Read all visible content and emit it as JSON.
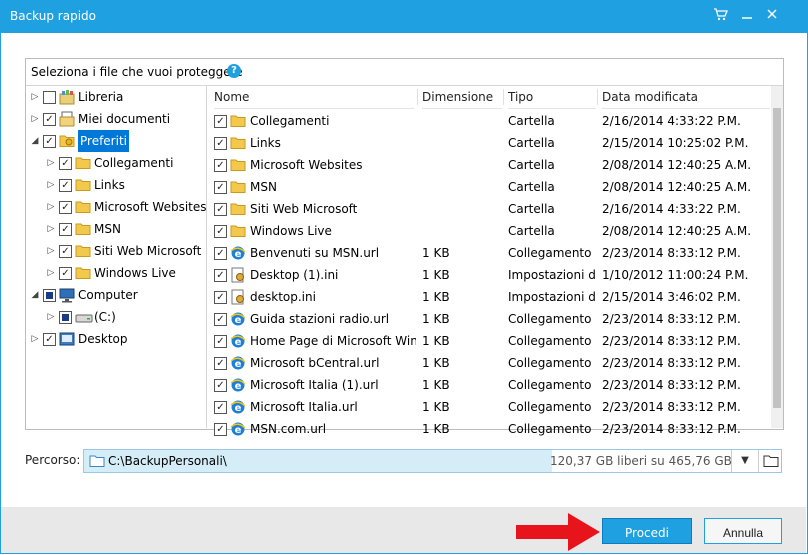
{
  "window": {
    "title": "Backup rapido"
  },
  "panel": {
    "instruction": "Seleziona i file che vuoi proteggere",
    "help_glyph": "?"
  },
  "tree": {
    "items": [
      {
        "label": "Libreria",
        "icon": "library-icon",
        "checked": "unchecked",
        "expander": "collapsed"
      },
      {
        "label": "Miei documenti",
        "icon": "documents-icon",
        "checked": "checked",
        "expander": "collapsed"
      },
      {
        "label": "Preferiti",
        "icon": "favorites-folder-icon",
        "checked": "checked",
        "expander": "expanded",
        "selected": true
      },
      {
        "label": "Collegamenti",
        "icon": "folder-icon",
        "checked": "checked",
        "expander": "collapsed"
      },
      {
        "label": "Links",
        "icon": "folder-icon",
        "checked": "checked",
        "expander": "collapsed"
      },
      {
        "label": "Microsoft Websites",
        "icon": "folder-icon",
        "checked": "checked",
        "expander": "collapsed"
      },
      {
        "label": "MSN",
        "icon": "folder-icon",
        "checked": "checked",
        "expander": "collapsed"
      },
      {
        "label": "Siti Web Microsoft",
        "icon": "folder-icon",
        "checked": "checked",
        "expander": "collapsed"
      },
      {
        "label": "Windows Live",
        "icon": "folder-icon",
        "checked": "checked",
        "expander": "collapsed"
      },
      {
        "label": "Computer",
        "icon": "computer-icon",
        "checked": "partial",
        "expander": "expanded"
      },
      {
        "label": "(C:)",
        "icon": "drive-icon",
        "checked": "partial",
        "expander": "collapsed"
      },
      {
        "label": "Desktop",
        "icon": "desktop-icon",
        "checked": "checked",
        "expander": "collapsed"
      }
    ]
  },
  "list": {
    "columns": [
      "Nome",
      "Dimensione",
      "Tipo",
      "Data modificata"
    ],
    "rows": [
      {
        "name": "Collegamenti",
        "size": "",
        "type": "Cartella",
        "date": "2/16/2014 4:33:22 P.M.",
        "icon": "folder-icon"
      },
      {
        "name": "Links",
        "size": "",
        "type": "Cartella",
        "date": "2/15/2014 10:25:02 P.M.",
        "icon": "folder-icon"
      },
      {
        "name": "Microsoft Websites",
        "size": "",
        "type": "Cartella",
        "date": "2/08/2014 12:40:25 A.M.",
        "icon": "folder-icon"
      },
      {
        "name": "MSN",
        "size": "",
        "type": "Cartella",
        "date": "2/08/2014 12:40:25 A.M.",
        "icon": "folder-icon"
      },
      {
        "name": "Siti Web Microsoft",
        "size": "",
        "type": "Cartella",
        "date": "2/16/2014 4:33:22 P.M.",
        "icon": "folder-icon"
      },
      {
        "name": "Windows Live",
        "size": "",
        "type": "Cartella",
        "date": "2/08/2014 12:40:25 A.M.",
        "icon": "folder-icon"
      },
      {
        "name": "Benvenuti su MSN.url",
        "size": "1 KB",
        "type": "Collegamento Internet",
        "date": "2/23/2014 8:33:12 P.M.",
        "icon": "ie-link-icon"
      },
      {
        "name": "Desktop (1).ini",
        "size": "1 KB",
        "type": "Impostazioni di configurazione",
        "date": "1/10/2012 11:00:24 P.M.",
        "icon": "ini-file-icon"
      },
      {
        "name": "desktop.ini",
        "size": "1 KB",
        "type": "Impostazioni di configurazione",
        "date": "2/15/2014 3:46:02 P.M.",
        "icon": "ini-file-icon"
      },
      {
        "name": "Guida stazioni radio.url",
        "size": "1 KB",
        "type": "Collegamento Internet",
        "date": "2/23/2014 8:33:12 P.M.",
        "icon": "ie-link-icon"
      },
      {
        "name": "Home Page di Microsoft Windows.url",
        "size": "1 KB",
        "type": "Collegamento Internet",
        "date": "2/23/2014 8:33:12 P.M.",
        "icon": "ie-link-icon"
      },
      {
        "name": "Microsoft bCentral.url",
        "size": "1 KB",
        "type": "Collegamento Internet",
        "date": "2/23/2014 8:33:12 P.M.",
        "icon": "ie-link-icon"
      },
      {
        "name": "Microsoft Italia (1).url",
        "size": "1 KB",
        "type": "Collegamento Internet",
        "date": "2/23/2014 8:33:12 P.M.",
        "icon": "ie-link-icon"
      },
      {
        "name": "Microsoft Italia.url",
        "size": "1 KB",
        "type": "Collegamento Internet",
        "date": "2/23/2014 8:33:12 P.M.",
        "icon": "ie-link-icon"
      },
      {
        "name": "MSN.com.url",
        "size": "1 KB",
        "type": "Collegamento Internet",
        "date": "2/23/2014 8:33:12 P.M.",
        "icon": "ie-link-icon"
      }
    ]
  },
  "path": {
    "label": "Percorso:",
    "value": "C:\\BackupPersonali\\",
    "free_space": "120,37 GB liberi su 465,76 GB",
    "free_fraction": 0.2584
  },
  "buttons": {
    "proceed": "Procedi",
    "cancel": "Annulla"
  },
  "colors": {
    "accent": "#1fa0e0",
    "arrow": "#e8141c",
    "folder": "#f2c94c"
  }
}
